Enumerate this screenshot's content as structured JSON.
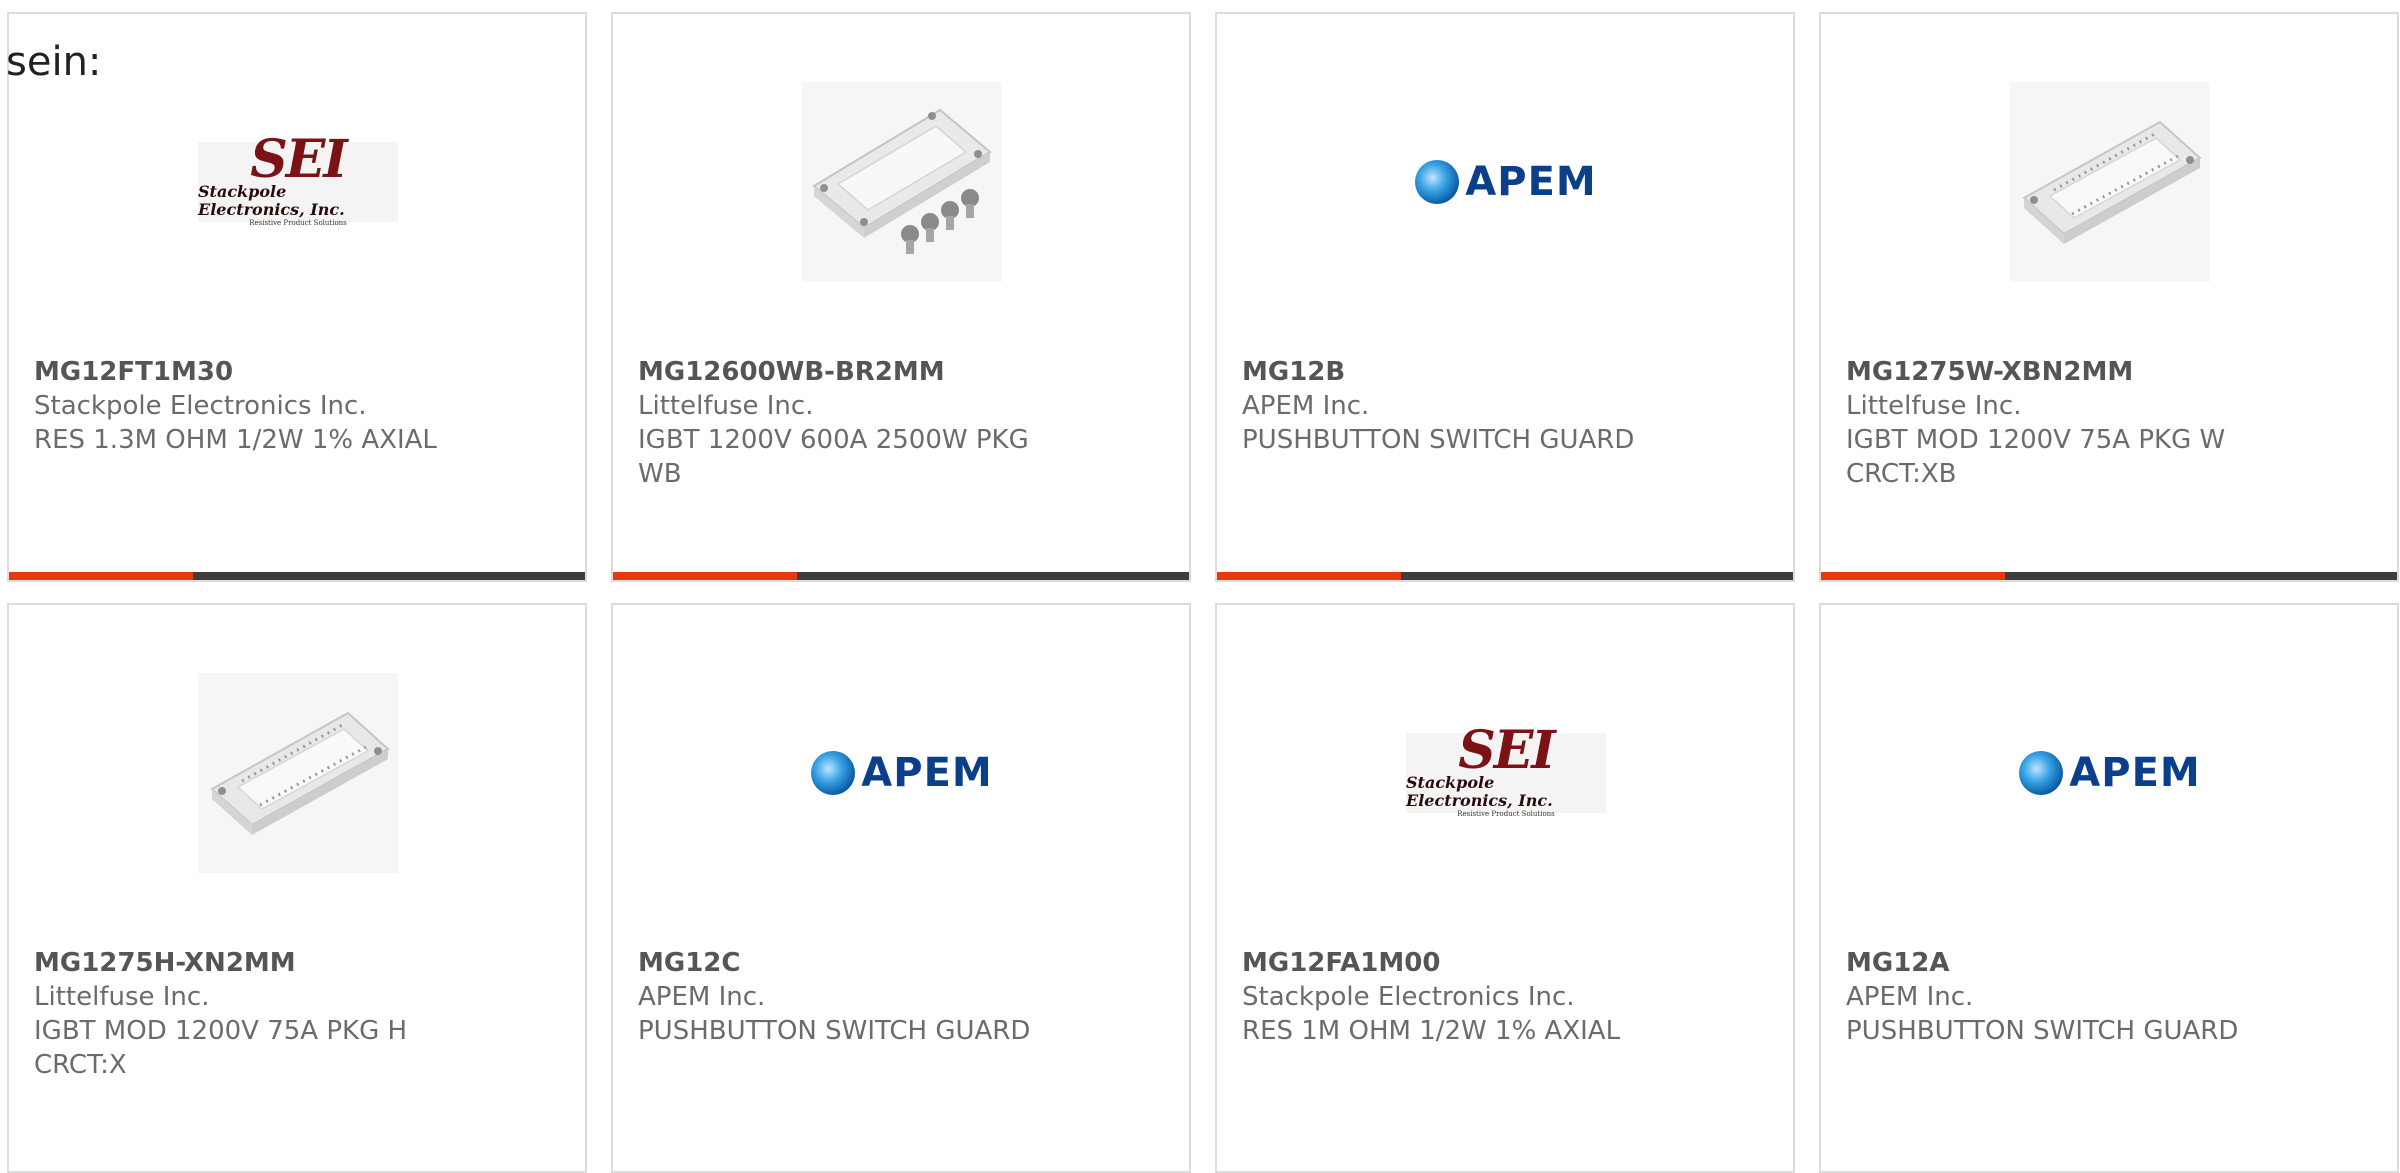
{
  "page": {
    "lead_text": "sein:"
  },
  "logos": {
    "sei": {
      "mark": "SEI",
      "name": "Stackpole Electronics, Inc.",
      "tagline": "Resistive Product Solutions"
    },
    "apem": {
      "text": "APEM"
    }
  },
  "products": [
    {
      "part_number": "MG12FT1M30",
      "manufacturer": "Stackpole Electronics Inc.",
      "description": "RES 1.3M OHM 1/2W 1% AXIAL",
      "image": "sei-logo",
      "progress": 0.32
    },
    {
      "part_number": "MG12600WB-BR2MM",
      "manufacturer": "Littelfuse Inc.",
      "description": "IGBT 1200V 600A 2500W PKG WB",
      "image": "igbt-module-with-screws",
      "progress": 0.32
    },
    {
      "part_number": "MG12B",
      "manufacturer": "APEM Inc.",
      "description": "PUSHBUTTON SWITCH GUARD",
      "image": "apem-logo",
      "progress": 0.32
    },
    {
      "part_number": "MG1275W-XBN2MM",
      "manufacturer": "Littelfuse Inc.",
      "description": "IGBT MOD 1200V 75A PKG W CRCT:XB",
      "image": "igbt-module",
      "progress": 0.32
    },
    {
      "part_number": "MG1275H-XN2MM",
      "manufacturer": "Littelfuse Inc.",
      "description": "IGBT MOD 1200V 75A PKG H CRCT:X",
      "image": "igbt-module",
      "progress": 0
    },
    {
      "part_number": "MG12C",
      "manufacturer": "APEM Inc.",
      "description": "PUSHBUTTON SWITCH GUARD",
      "image": "apem-logo",
      "progress": 0
    },
    {
      "part_number": "MG12FA1M00",
      "manufacturer": "Stackpole Electronics Inc.",
      "description": "RES 1M OHM 1/2W 1% AXIAL",
      "image": "sei-logo",
      "progress": 0
    },
    {
      "part_number": "MG12A",
      "manufacturer": "APEM Inc.",
      "description": "PUSHBUTTON SWITCH GUARD",
      "image": "apem-logo",
      "progress": 0
    }
  ],
  "colors": {
    "accent": "#e8380e",
    "track": "#3d3d3d",
    "card_border": "#dcdcdc",
    "text": "#6b6b6b"
  }
}
